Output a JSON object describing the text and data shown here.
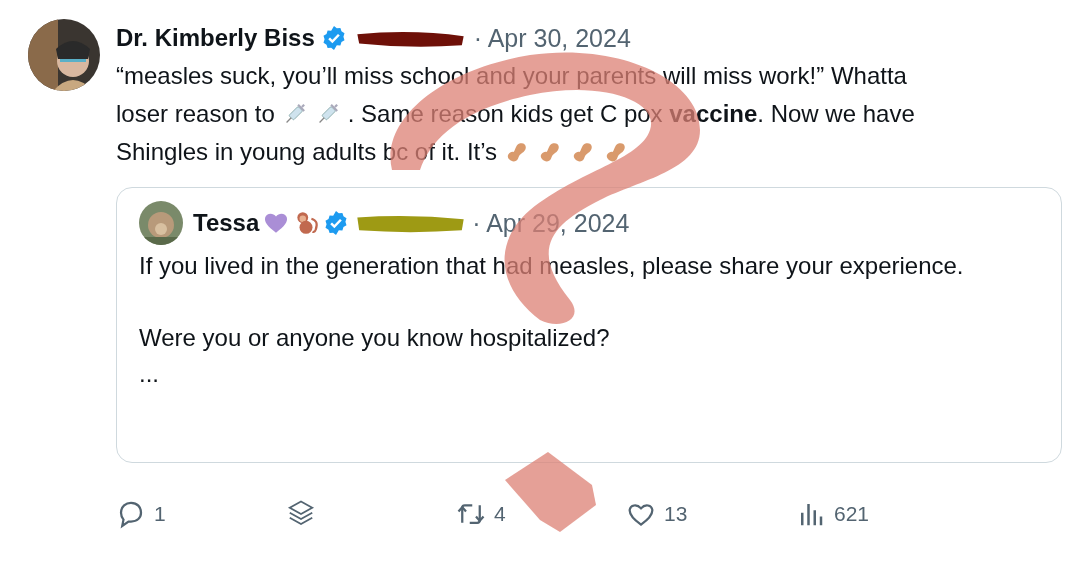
{
  "post": {
    "author": "Dr. Kimberly Biss",
    "verified": true,
    "date": "· Apr 30, 2024",
    "body": [
      {
        "segments": [
          {
            "kind": "text",
            "text": "“measles suck, you’ll miss school and your parents will miss work!” Whatta"
          }
        ]
      },
      {
        "segments": [
          {
            "kind": "text",
            "text": "loser reason to"
          },
          {
            "kind": "syringe"
          },
          {
            "kind": "syringe"
          },
          {
            "kind": "text",
            "text": ". Same reason kids get C pox **vaccine**. Now we have"
          }
        ]
      },
      {
        "segments": [
          {
            "kind": "text",
            "text": "Shingles in young adults bc of it. It’s"
          },
          {
            "kind": "peanut"
          },
          {
            "kind": "peanut"
          },
          {
            "kind": "peanut"
          },
          {
            "kind": "peanut"
          }
        ]
      }
    ],
    "quote": {
      "author": "Tessa",
      "badges": [
        {
          "kind": "heart"
        },
        {
          "kind": "monkey"
        }
      ],
      "verified": true,
      "date": "· Apr 29, 2024",
      "paragraphs": [
        "If you lived in the generation that had measles, please share your experience.",
        "Were you or anyone you know hospitalized?",
        "..."
      ]
    },
    "actions": [
      {
        "kind": "reply",
        "count": "1"
      },
      {
        "kind": "layers"
      },
      {
        "kind": "repost",
        "count": "4"
      },
      {
        "kind": "like",
        "count": "13"
      },
      {
        "kind": "views",
        "count": "621"
      }
    ]
  }
}
